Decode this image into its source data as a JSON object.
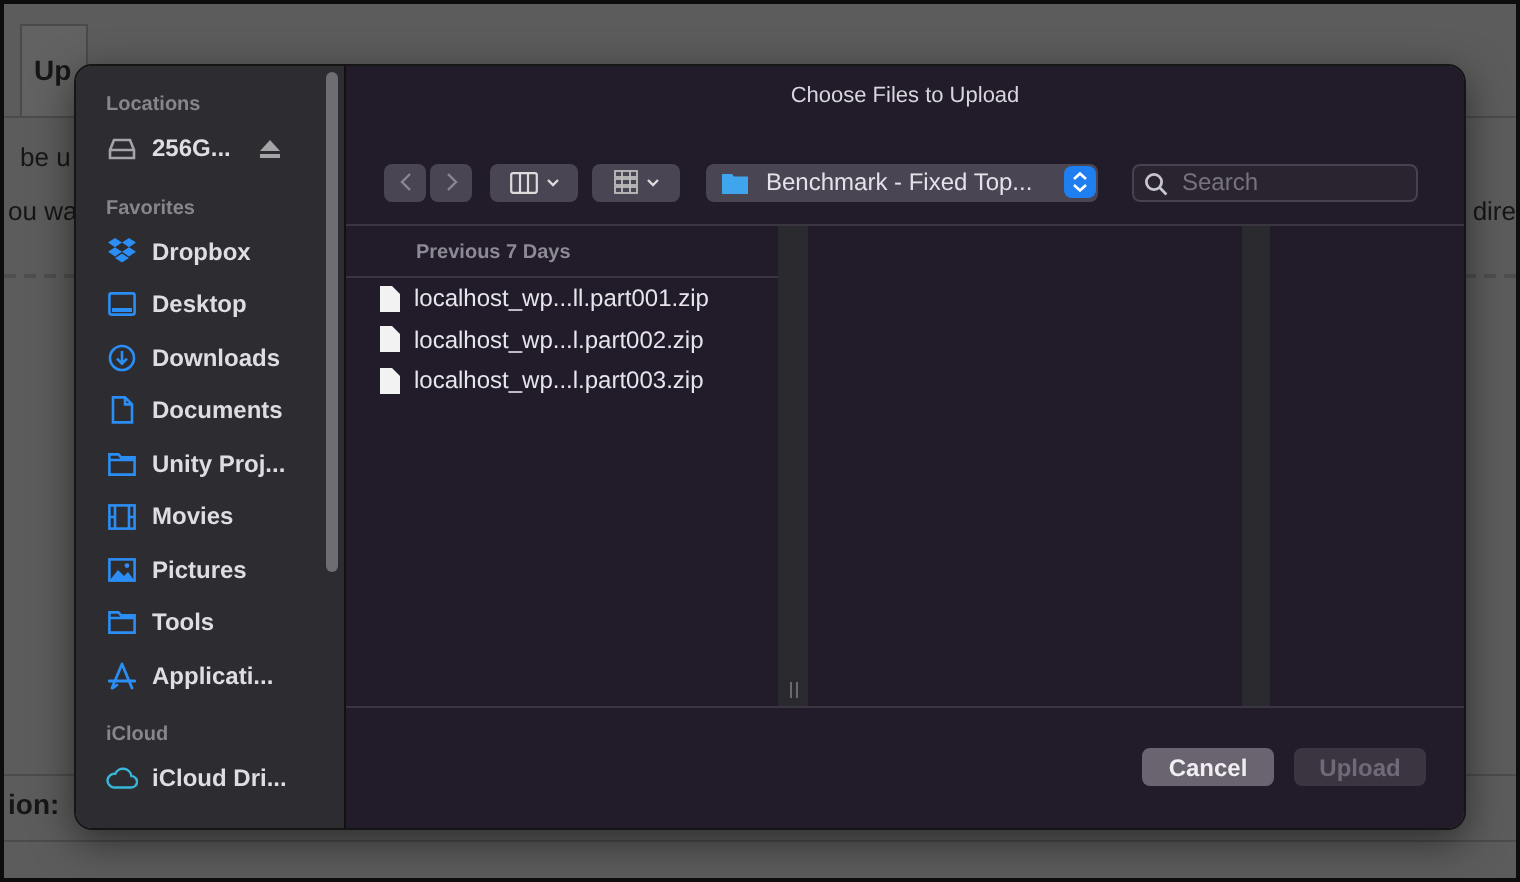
{
  "backdrop": {
    "tab": "Up",
    "line_1": "be u",
    "line_2_left": "ou wa",
    "line_2_right": "dire",
    "footer": "ion:"
  },
  "dialog": {
    "title": "Choose Files to Upload",
    "sidebar": [
      {
        "heading": "Locations",
        "items": [
          {
            "label": "256G...",
            "kind": "drive",
            "eject": true
          }
        ]
      },
      {
        "heading": "Favorites",
        "items": [
          {
            "label": "Dropbox",
            "kind": "dropbox"
          },
          {
            "label": "Desktop",
            "kind": "desktop"
          },
          {
            "label": "Downloads",
            "kind": "downloads"
          },
          {
            "label": "Documents",
            "kind": "document"
          },
          {
            "label": "Unity Proj...",
            "kind": "folder"
          },
          {
            "label": "Movies",
            "kind": "movies"
          },
          {
            "label": "Pictures",
            "kind": "pictures"
          },
          {
            "label": "Tools",
            "kind": "folder"
          },
          {
            "label": "Applicati...",
            "kind": "applications"
          }
        ]
      },
      {
        "heading": "iCloud",
        "items": [
          {
            "label": "iCloud Dri...",
            "kind": "cloud"
          }
        ]
      }
    ],
    "toolbar": {
      "back_disabled": true,
      "forward_disabled": true,
      "location": "Benchmark - Fixed Top...",
      "search": {
        "placeholder": "Search"
      }
    },
    "column_heading": "Previous 7 Days",
    "files": [
      {
        "name": "localhost_wp...ll.part001.zip"
      },
      {
        "name": "localhost_wp...l.part002.zip"
      },
      {
        "name": "localhost_wp...l.part003.zip"
      }
    ],
    "buttons": [
      {
        "label": "Cancel",
        "disabled": false
      },
      {
        "label": "Upload",
        "disabled": true
      }
    ]
  }
}
